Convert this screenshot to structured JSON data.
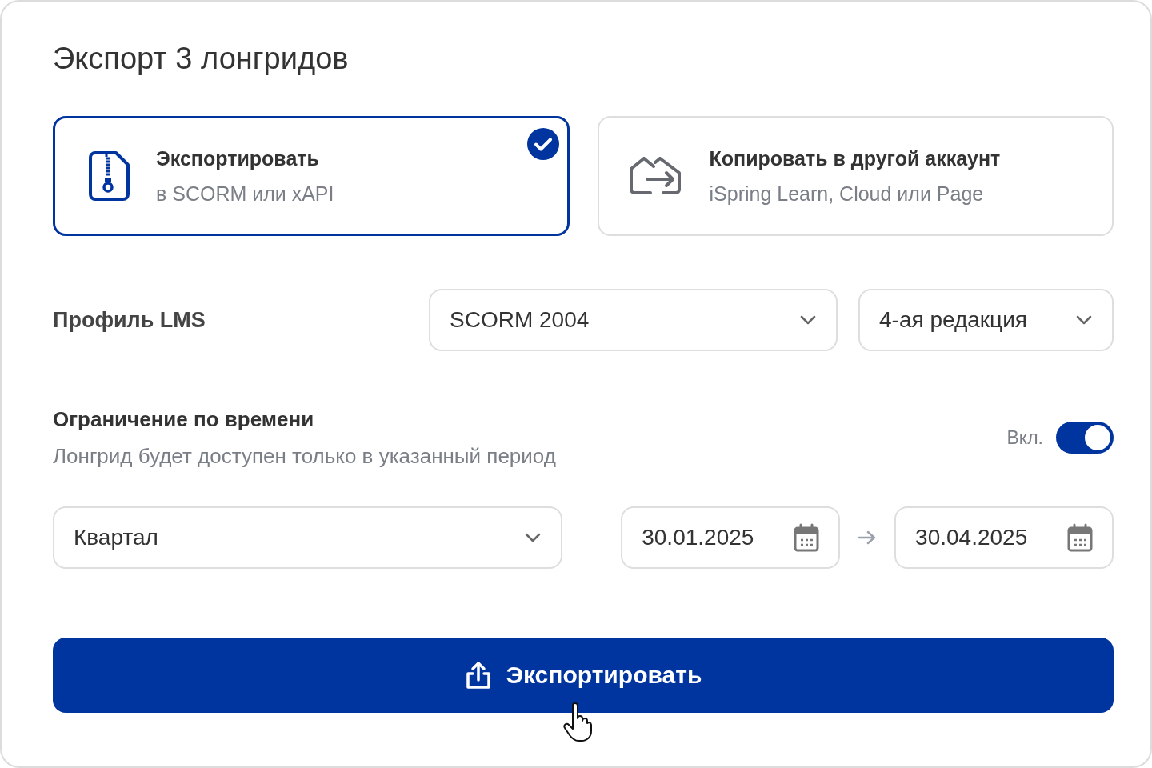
{
  "title": "Экспорт 3 лонгридов",
  "options": [
    {
      "kind": "zip",
      "title": "Экспортировать",
      "subtitle": "в SCORM или xAPI",
      "selected": true
    },
    {
      "kind": "transfer",
      "title": "Копировать в другой аккаунт",
      "subtitle": "iSpring Learn, Cloud или Page",
      "selected": false
    }
  ],
  "lms_profile": {
    "label": "Профиль LMS",
    "standard": "SCORM 2004",
    "edition": "4-ая редакция"
  },
  "time_limit": {
    "title": "Ограничение по времени",
    "description": "Лонгрид будет доступен только в указанный период",
    "toggle_label": "Вкл.",
    "on": true,
    "period": "Квартал",
    "start_date": "30.01.2025",
    "end_date": "30.04.2025"
  },
  "export_button": "Экспортировать"
}
